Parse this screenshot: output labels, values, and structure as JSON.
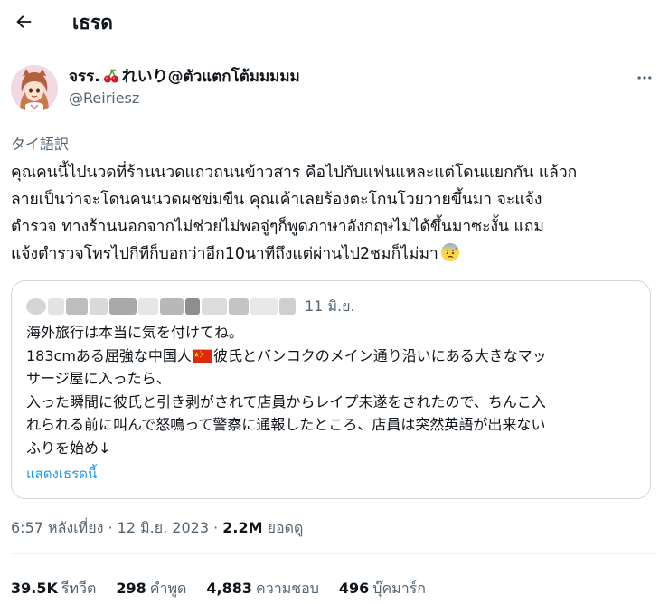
{
  "header": {
    "title": "เธรด",
    "back_icon": "arrow-left-icon"
  },
  "author": {
    "name_prefix": "จรร.",
    "name_suffix": "れいり@ตัวแตกโต้มมมมม",
    "handle": "@Reiriesz",
    "name_emoji": "cherry-icon"
  },
  "post": {
    "translation_label": "タイ語訳",
    "lines": [
      "คุณคนนี้ไปนวดที่ร้านนวดแถวถนนข้าวสาร คือไปกับแฟนแหละแต่โดนแยกกัน แล้วก",
      "ลายเป็นว่าจะโดนคนนวดผชข่มขืน คุณเค้าเลยร้องตะโกนโวยวายขึ้นมา จะแจ้ง",
      "ตำรวจ ทางร้านนอกจากไม่ช่วยไม่พอจู่ๆก็พูดภาษาอังกฤษไม่ได้ขึ้นมาซะงั้น แถม",
      "แจ้งตำรวจโทรไปกี่ทีก็บอกว่าอีก10นาทีถึงแต่ผ่านไป2ชมก็ไม่มา"
    ],
    "end_emoji": "anxious-sweat-face-icon"
  },
  "quote": {
    "date": "11 มิ.ย.",
    "line1": "海外旅行は本当に気を付けてね。",
    "line2_before_flag": "183cmある屈強な中国人",
    "line2_after_flag": "彼氏とバンコクのメイン通り沿いにある大きなマッ",
    "line3": "サージ屋に入ったら、",
    "line4": "入った瞬間に彼氏と引き剥がされて店員からレイプ未遂をされたので、ちんこ入",
    "line5": "れられる前に叫んで怒鳴って警察に通報したところ、店員は突然英語が出来ない",
    "line6": "ふりを始め↓",
    "show_thread": "แสดงเธรดนี้",
    "flag_emoji": "china-flag-icon"
  },
  "meta": {
    "time": "6:57 หลังเที่ยง",
    "sep": "·",
    "date": "12 มิ.ย. 2023",
    "views_count": "2.2M",
    "views_label": "ยอดดู"
  },
  "stats": {
    "retweets_count": "39.5K",
    "retweets_label": "รีทวีต",
    "quotes_count": "298",
    "quotes_label": "คำพูด",
    "likes_count": "4,883",
    "likes_label": "ความชอบ",
    "bookmarks_count": "496",
    "bookmarks_label": "บุ๊คมาร์ก"
  },
  "colors": {
    "text": "#0f1419",
    "secondary": "#536471",
    "link": "#1d9bf0",
    "border": "#cfd9de",
    "divider": "#eff3f4"
  }
}
